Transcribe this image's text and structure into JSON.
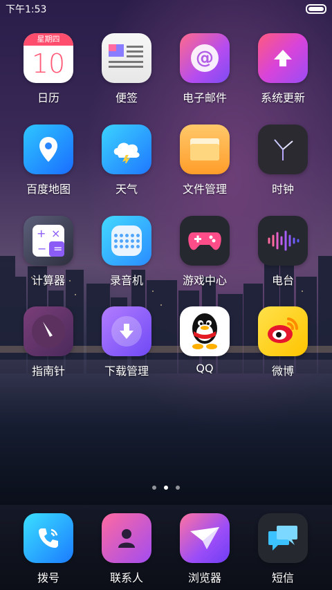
{
  "status_bar": {
    "time": "下午1:53"
  },
  "apps": [
    {
      "label": "日历",
      "icon": "calendar-icon",
      "calendar_weekday": "星期四",
      "calendar_day": "10"
    },
    {
      "label": "便签",
      "icon": "notes-icon"
    },
    {
      "label": "电子邮件",
      "icon": "email-icon"
    },
    {
      "label": "系统更新",
      "icon": "system-update-icon"
    },
    {
      "label": "百度地图",
      "icon": "maps-icon"
    },
    {
      "label": "天气",
      "icon": "weather-icon"
    },
    {
      "label": "文件管理",
      "icon": "file-manager-icon"
    },
    {
      "label": "时钟",
      "icon": "clock-icon"
    },
    {
      "label": "计算器",
      "icon": "calculator-icon"
    },
    {
      "label": "录音机",
      "icon": "recorder-icon"
    },
    {
      "label": "游戏中心",
      "icon": "game-center-icon"
    },
    {
      "label": "电台",
      "icon": "radio-icon"
    },
    {
      "label": "指南针",
      "icon": "compass-icon"
    },
    {
      "label": "下载管理",
      "icon": "download-manager-icon"
    },
    {
      "label": "QQ",
      "icon": "qq-icon"
    },
    {
      "label": "微博",
      "icon": "weibo-icon"
    }
  ],
  "dock": [
    {
      "label": "拨号",
      "icon": "phone-icon"
    },
    {
      "label": "联系人",
      "icon": "contacts-icon"
    },
    {
      "label": "浏览器",
      "icon": "browser-icon"
    },
    {
      "label": "短信",
      "icon": "messages-icon"
    }
  ],
  "pager": {
    "count": 3,
    "active": 2
  }
}
